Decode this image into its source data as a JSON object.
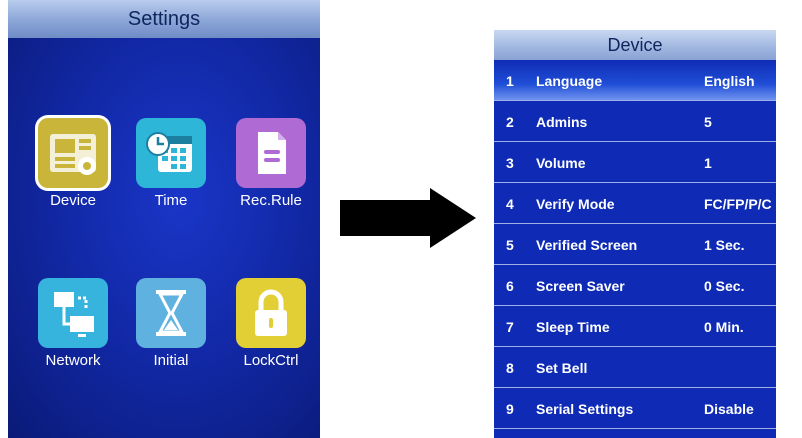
{
  "settings_screen": {
    "title": "Settings",
    "apps": [
      {
        "label": "Device",
        "icon": "device-icon",
        "color": "#c9b53a",
        "selected": true
      },
      {
        "label": "Time",
        "icon": "calendar-clock-icon",
        "color": "#2eb6d8"
      },
      {
        "label": "Rec.Rule",
        "icon": "document-icon",
        "color": "#b06ad3"
      },
      {
        "label": "Network",
        "icon": "network-icon",
        "color": "#37b4de"
      },
      {
        "label": "Initial",
        "icon": "hourglass-icon",
        "color": "#5fb1e0"
      },
      {
        "label": "LockCtrl",
        "icon": "lock-icon",
        "color": "#e2cf35"
      }
    ]
  },
  "arrow": {
    "icon": "right-arrow-icon",
    "color": "#000000"
  },
  "device_screen": {
    "title": "Device",
    "items": [
      {
        "num": "1",
        "label": "Language",
        "value": "English",
        "selected": true
      },
      {
        "num": "2",
        "label": "Admins",
        "value": "5"
      },
      {
        "num": "3",
        "label": "Volume",
        "value": "1"
      },
      {
        "num": "4",
        "label": "Verify Mode",
        "value": "FC/FP/P/C"
      },
      {
        "num": "5",
        "label": "Verified Screen",
        "value": "1 Sec."
      },
      {
        "num": "6",
        "label": "Screen Saver",
        "value": "0 Sec."
      },
      {
        "num": "7",
        "label": "Sleep Time",
        "value": "0 Min."
      },
      {
        "num": "8",
        "label": "Set Bell",
        "value": ""
      },
      {
        "num": "9",
        "label": "Serial Settings",
        "value": "Disable"
      }
    ]
  }
}
